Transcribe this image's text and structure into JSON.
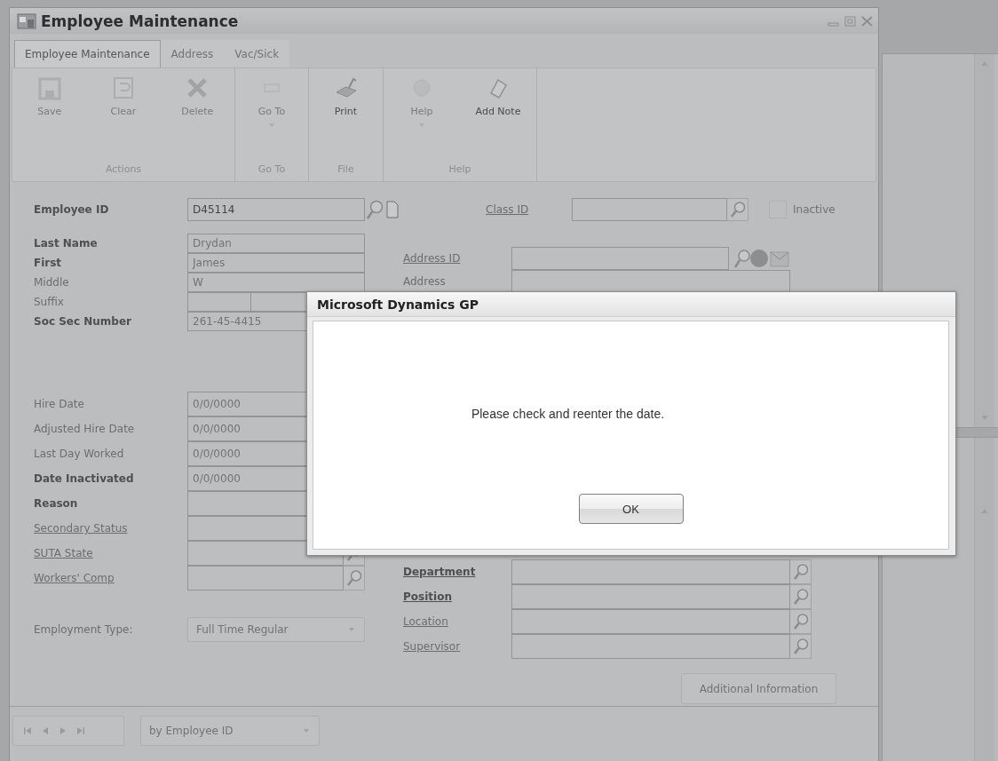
{
  "window": {
    "title": "Employee Maintenance"
  },
  "tabs": [
    {
      "label": "Employee Maintenance",
      "selected": true
    },
    {
      "label": "Address",
      "selected": false
    },
    {
      "label": "Vac/Sick",
      "selected": false
    }
  ],
  "ribbon": {
    "groups": [
      {
        "label": "Actions",
        "buttons": [
          {
            "label": "Save",
            "disabled": true,
            "dropdown": false
          },
          {
            "label": "Clear",
            "disabled": true,
            "dropdown": false
          },
          {
            "label": "Delete",
            "disabled": true,
            "dropdown": false
          }
        ]
      },
      {
        "label": "Go To",
        "buttons": [
          {
            "label": "Go To",
            "disabled": true,
            "dropdown": true
          }
        ]
      },
      {
        "label": "File",
        "buttons": [
          {
            "label": "Print",
            "disabled": false,
            "dropdown": false
          }
        ]
      },
      {
        "label": "Help",
        "buttons": [
          {
            "label": "Help",
            "disabled": true,
            "dropdown": true
          },
          {
            "label": "Add Note",
            "disabled": false,
            "dropdown": false
          }
        ]
      }
    ]
  },
  "form": {
    "employee_id": {
      "label": "Employee ID",
      "value": "D45114",
      "disabled": false
    },
    "class_id": {
      "label": "Class ID"
    },
    "inactive": {
      "label": "Inactive",
      "checked": false
    },
    "left_groups": [
      [
        {
          "label": "Last Name",
          "bold": true,
          "link": false,
          "kind": "text",
          "value": "Drydan",
          "disabled": true
        },
        {
          "label": "First",
          "bold": true,
          "link": false,
          "kind": "text",
          "value": "James",
          "disabled": true
        },
        {
          "label": "Middle",
          "bold": false,
          "link": false,
          "kind": "text",
          "value": "W",
          "disabled": true
        },
        {
          "label": "Suffix",
          "bold": false,
          "link": false,
          "kind": "split"
        },
        {
          "label": "Soc Sec Number",
          "bold": true,
          "link": false,
          "kind": "text",
          "value": "261-45-4415",
          "disabled": true
        }
      ],
      [
        {
          "label": "Hire Date",
          "bold": false,
          "link": false,
          "kind": "text",
          "value": "0/0/0000",
          "disabled": true
        },
        {
          "label": "Adjusted Hire Date",
          "bold": false,
          "link": false,
          "kind": "text",
          "value": "0/0/0000",
          "disabled": true
        },
        {
          "label": "Last Day Worked",
          "bold": false,
          "link": false,
          "kind": "text",
          "value": "0/0/0000",
          "disabled": true
        },
        {
          "label": "Date Inactivated",
          "bold": true,
          "link": false,
          "kind": "text",
          "value": "0/0/0000",
          "disabled": true
        },
        {
          "label": "Reason",
          "bold": true,
          "link": false,
          "kind": "text"
        },
        {
          "label": "Secondary Status",
          "bold": false,
          "link": true,
          "kind": "text"
        },
        {
          "label": "SUTA State",
          "bold": false,
          "link": true,
          "kind": "lookup"
        },
        {
          "label": "Workers' Comp",
          "bold": false,
          "link": true,
          "kind": "lookup"
        }
      ]
    ],
    "employment_type": {
      "label": "Employment Type:",
      "value": "Full Time Regular"
    },
    "right_groups": [
      [
        {
          "label": "Address ID",
          "bold": false,
          "link": true,
          "kind": "address"
        },
        {
          "label": "Address",
          "bold": false,
          "link": false,
          "kind": "text"
        }
      ],
      [
        {
          "label": "Department",
          "bold": true,
          "link": true,
          "kind": "lookup"
        },
        {
          "label": "Position",
          "bold": true,
          "link": true,
          "kind": "lookup"
        },
        {
          "label": "Location",
          "bold": false,
          "link": true,
          "kind": "lookup"
        },
        {
          "label": "Supervisor",
          "bold": false,
          "link": true,
          "kind": "lookup"
        }
      ]
    ],
    "additional_button": {
      "label": "Additional Information",
      "disabled": true
    }
  },
  "navigation": {
    "sort": "by Employee ID"
  },
  "dialog": {
    "title": "Microsoft Dynamics GP",
    "message": "Please check and reenter the date.",
    "buttons": [
      "OK"
    ]
  }
}
